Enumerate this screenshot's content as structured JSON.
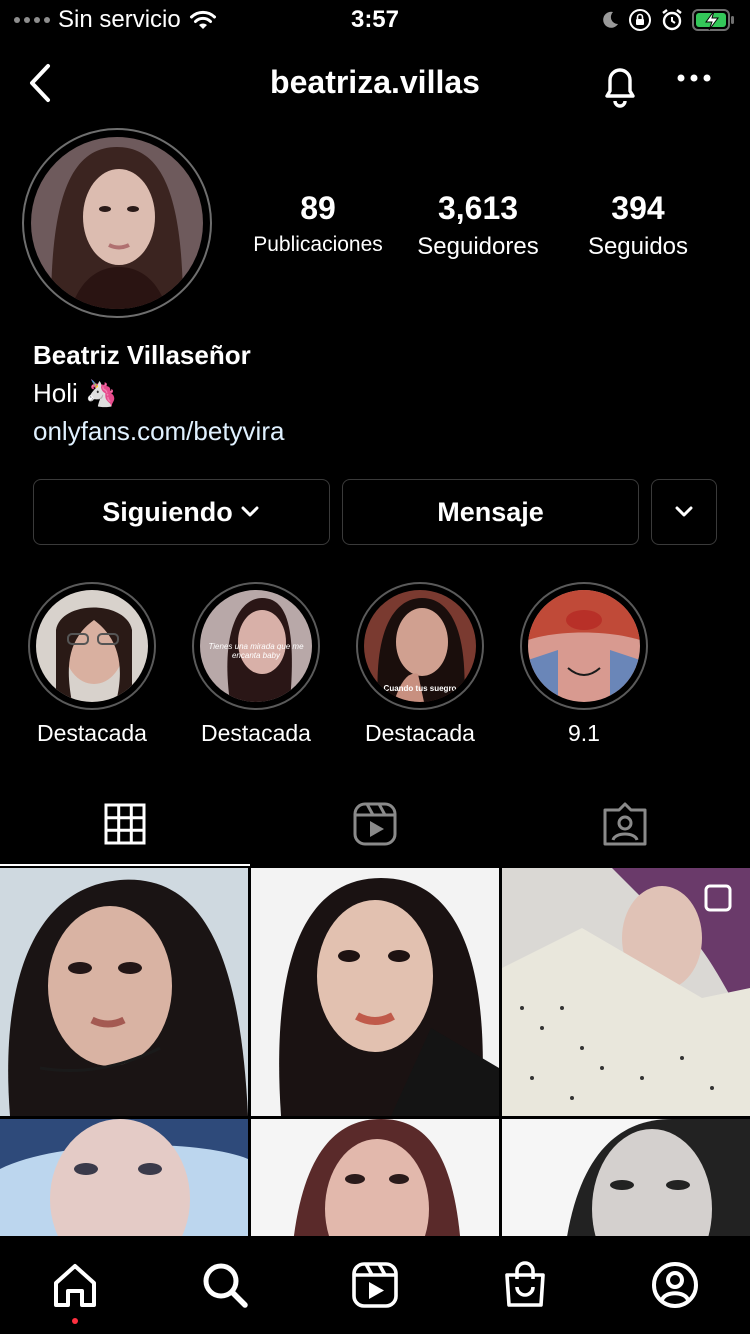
{
  "status_bar": {
    "carrier": "Sin servicio",
    "time": "3:57",
    "icons": [
      "wifi-icon",
      "moon-icon",
      "orientation-lock-icon",
      "alarm-icon",
      "battery-charging-icon"
    ]
  },
  "header": {
    "username": "beatriza.villas",
    "icons": [
      "back-chevron-icon",
      "bell-icon",
      "more-icon"
    ]
  },
  "profile": {
    "stats": [
      {
        "value": "89",
        "label": "Publicaciones"
      },
      {
        "value": "3,613",
        "label": "Seguidores"
      },
      {
        "value": "394",
        "label": "Seguidos"
      }
    ],
    "full_name": "Beatriz Villaseñor",
    "bio": "Holi 🦄",
    "link": "onlyfans.com/betyvira"
  },
  "actions": {
    "following": "Siguiendo",
    "message": "Mensaje"
  },
  "highlights": [
    {
      "label": "Destacada"
    },
    {
      "label": "Destacada"
    },
    {
      "label": "Destacada"
    },
    {
      "label": "9.1"
    }
  ],
  "highlight_overlay_text": [
    "Tienes una mirada que me encanta baby",
    "Cuando tus suegro"
  ],
  "tabs": [
    "grid-icon",
    "reels-icon",
    "tagged-icon"
  ],
  "bottom_nav": [
    "home-icon",
    "search-icon",
    "reels-icon",
    "shop-icon",
    "profile-icon"
  ],
  "colors": {
    "background": "#000000",
    "text": "#ffffff",
    "link": "#e0f1ff",
    "border": "#3a3a3a",
    "battery": "#34c759",
    "notification_dot": "#ff3040"
  }
}
